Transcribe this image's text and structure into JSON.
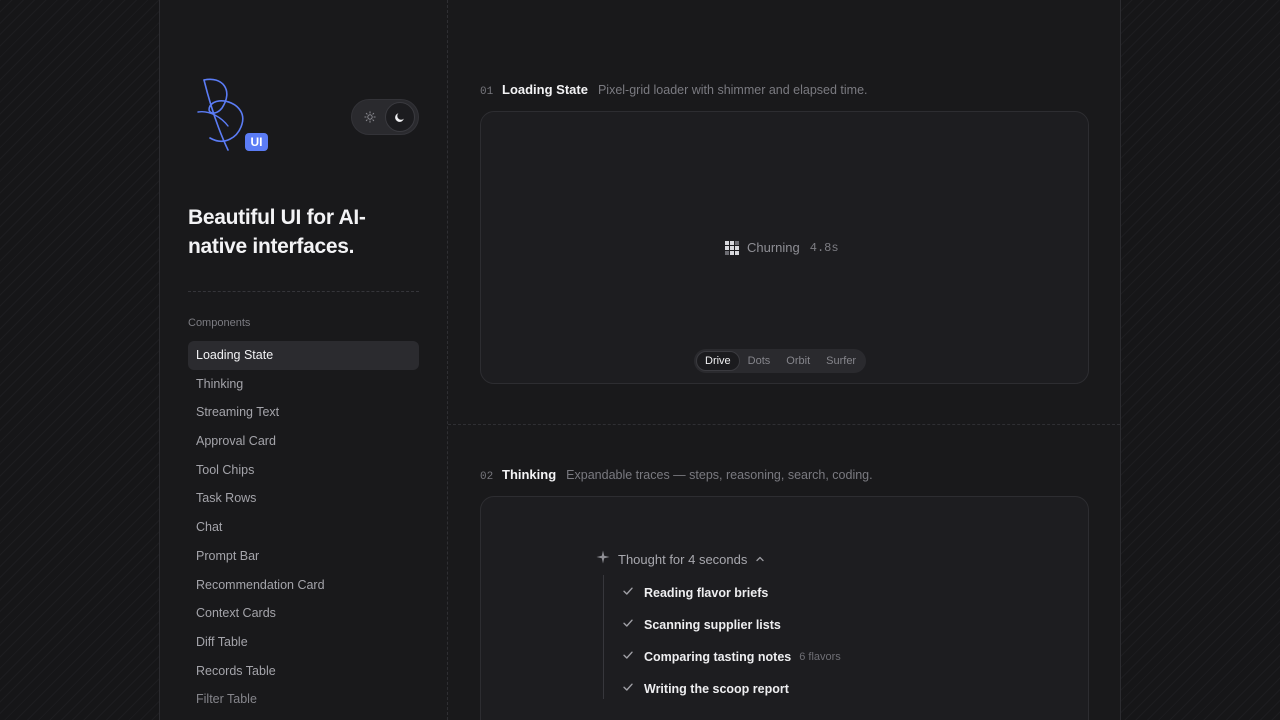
{
  "brand": {
    "logo_badge": "UI",
    "tagline": "Beautiful UI for AI-native interfaces."
  },
  "theme_toggle": {
    "options": [
      "sun-icon",
      "moon-icon"
    ],
    "selected": "dark"
  },
  "sidebar": {
    "section_label": "Components",
    "items": [
      {
        "label": "Loading State",
        "active": true
      },
      {
        "label": "Thinking"
      },
      {
        "label": "Streaming Text"
      },
      {
        "label": "Approval Card"
      },
      {
        "label": "Tool Chips"
      },
      {
        "label": "Task Rows"
      },
      {
        "label": "Chat"
      },
      {
        "label": "Prompt Bar"
      },
      {
        "label": "Recommendation Card"
      },
      {
        "label": "Context Cards"
      },
      {
        "label": "Diff Table"
      },
      {
        "label": "Records Table"
      },
      {
        "label": "Filter Table"
      }
    ]
  },
  "sections": [
    {
      "number": "01",
      "title": "Loading State",
      "description": "Pixel-grid loader with shimmer and elapsed time.",
      "loader": {
        "label": "Churning",
        "elapsed": "4.8s"
      },
      "variants": [
        "Drive",
        "Dots",
        "Orbit",
        "Surfer"
      ],
      "selected_variant": "Drive"
    },
    {
      "number": "02",
      "title": "Thinking",
      "description": "Expandable traces — steps, reasoning, search, coding.",
      "thought": {
        "title": "Thought for 4 seconds",
        "steps": [
          {
            "label": "Reading flavor briefs"
          },
          {
            "label": "Scanning supplier lists"
          },
          {
            "label": "Comparing tasting notes",
            "meta": "6 flavors"
          },
          {
            "label": "Writing the scoop report"
          }
        ]
      }
    }
  ],
  "colors": {
    "accent": "#5b7cf5",
    "background": "#19191b",
    "card": "#1d1d20"
  }
}
